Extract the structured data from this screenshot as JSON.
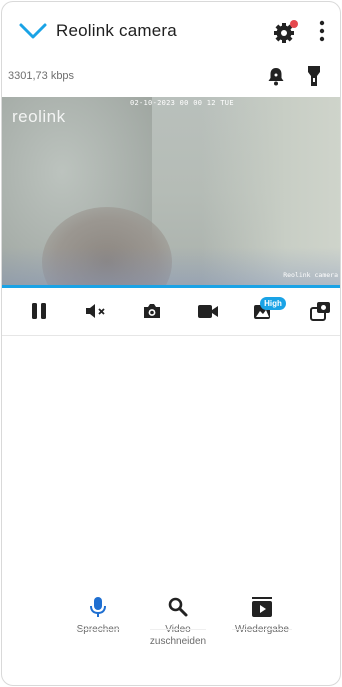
{
  "header": {
    "title": "Reolink camera",
    "icons": [
      "chevron-down-icon",
      "gear-icon",
      "more-vertical-icon"
    ],
    "notification_dot_color": "#e5484d"
  },
  "status": {
    "bitrate": "3301,73 kbps",
    "icons": [
      "bell-icon",
      "flashlight-icon"
    ]
  },
  "video": {
    "logo": "reolink",
    "timestamp": "02-10-2023 00 00 12 TUE",
    "watermark": "Reolink camera"
  },
  "toolbar": {
    "items": [
      "pause-icon",
      "mute-icon",
      "snapshot-icon",
      "record-icon",
      "quality-icon",
      "camera-switch-icon"
    ],
    "quality_badge": "High",
    "accent": "#1aa3e6"
  },
  "actions": [
    {
      "label": "Sprechen",
      "icon": "microphone-icon"
    },
    {
      "label": "Video\nzuschneiden",
      "icon": "search-icon"
    },
    {
      "label": "Wiedergabe",
      "icon": "playback-icon"
    }
  ]
}
